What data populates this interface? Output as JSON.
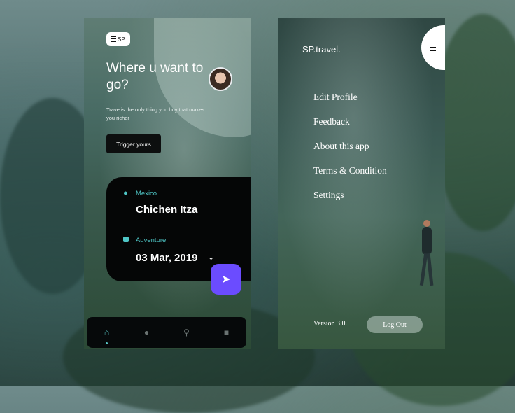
{
  "left_screen": {
    "menu_button": {
      "icon": "hamburger-icon",
      "label": "SP."
    },
    "title": "Where u want to go?",
    "subtitle": "Trave is the only thing you buy that makes you richer",
    "trigger_button": "Trigger yours",
    "card": {
      "location_label": "Mexico",
      "place": "Chichen Itza",
      "category_label": "Adventure",
      "date": "03 Mar, 2019"
    },
    "fab": {
      "icon": "send-icon"
    },
    "bottom_nav": [
      "home-icon",
      "location-pin-icon",
      "search-icon",
      "square-icon"
    ]
  },
  "right_screen": {
    "brand": "SP.travel.",
    "menu": [
      "Edit Profile",
      "Feedback",
      "About this app",
      "Terms & Condition",
      "Settings"
    ],
    "version": "Version 3.0.",
    "logout_button": "Log Out"
  },
  "colors": {
    "accent": "#4fc6c6",
    "fab": "#6b4cff",
    "card": "#050606",
    "nav": "#06090a"
  }
}
